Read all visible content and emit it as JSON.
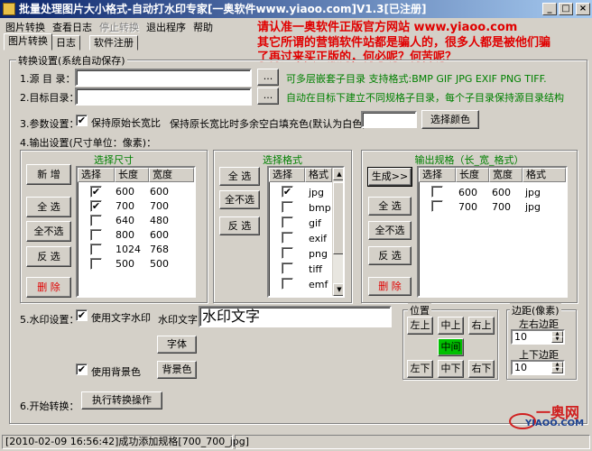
{
  "window": {
    "title": "批量处理图片大小格式-自动打水印专家[一奥软件www.yiaoo.com]V1.3[已注册]",
    "controls": [
      "_",
      "□",
      "×"
    ]
  },
  "menu": {
    "items": [
      {
        "label": "图片转换",
        "disabled": false
      },
      {
        "label": "查看日志",
        "disabled": false
      },
      {
        "label": "停止转换",
        "disabled": true
      },
      {
        "label": "退出程序",
        "disabled": false
      },
      {
        "label": "帮助",
        "disabled": false
      }
    ]
  },
  "tabs": [
    "图片转换",
    "日志",
    "软件注册"
  ],
  "promo": {
    "line1": "请认准一奥软件正版官方网站 www.yiaoo.com",
    "line2": "其它所谓的营销软件站都是骗人的，很多人都是被他们骗",
    "line3": "了再过来买正版的，何必呢？何苦呢？"
  },
  "convert_settings": {
    "legend": "转换设置(系统自动保存)",
    "source_label": "1.源 目 录：",
    "source_value": "",
    "browse_label": "...",
    "source_hint": "可多层嵌套子目录 支持格式:BMP GIF JPG EXIF PNG TIFF.",
    "target_label": "2.目标目录：",
    "target_value": "",
    "target_hint": "自动在目标下建立不同规格子目录，每个子目录保持源目录结构",
    "params_label": "3.参数设置：",
    "keep_ratio_label": "保持原始长宽比",
    "keep_ratio_checked": true,
    "fill_label": "保持原长宽比时多余空白填充色(默认为白色)：",
    "fill_value": "",
    "choose_color_label": "选择颜色",
    "output_label": "4.输出设置(尺寸单位：像素)："
  },
  "size_panel": {
    "title": "选择尺寸",
    "buttons": {
      "add": "新  增",
      "all": "全  选",
      "none": "全不选",
      "invert": "反  选",
      "delete": "删  除"
    },
    "columns": [
      "选择",
      "长度",
      "宽度"
    ],
    "rows": [
      {
        "checked": true,
        "length": "600",
        "width": "600"
      },
      {
        "checked": true,
        "length": "700",
        "width": "700"
      },
      {
        "checked": false,
        "length": "640",
        "width": "480"
      },
      {
        "checked": false,
        "length": "800",
        "width": "600"
      },
      {
        "checked": false,
        "length": "1024",
        "width": "768"
      },
      {
        "checked": false,
        "length": "500",
        "width": "500"
      }
    ]
  },
  "format_panel": {
    "title": "选择格式",
    "buttons": {
      "all": "全  选",
      "none": "全不选",
      "invert": "反  选"
    },
    "columns": [
      "选择",
      "格式"
    ],
    "rows": [
      {
        "checked": true,
        "format": "jpg"
      },
      {
        "checked": false,
        "format": "bmp"
      },
      {
        "checked": false,
        "format": "gif"
      },
      {
        "checked": false,
        "format": "exif"
      },
      {
        "checked": false,
        "format": "png"
      },
      {
        "checked": false,
        "format": "tiff"
      },
      {
        "checked": false,
        "format": "emf"
      }
    ]
  },
  "output_panel": {
    "title": "输出规格（长_宽_格式）",
    "buttons": {
      "generate": "生成>>",
      "all": "全  选",
      "none": "全不选",
      "invert": "反  选",
      "delete": "删  除"
    },
    "columns": [
      "选择",
      "长度",
      "宽度",
      "格式"
    ],
    "rows": [
      {
        "checked": false,
        "length": "600",
        "width": "600",
        "format": "jpg"
      },
      {
        "checked": false,
        "length": "700",
        "width": "700",
        "format": "jpg"
      }
    ]
  },
  "watermark": {
    "label": "5.水印设置：",
    "use_text_label": "使用文字水印",
    "use_text_checked": true,
    "text_label": "水印文字",
    "text_value": "水印文字",
    "font_label": "字体",
    "use_bg_label": "使用背景色",
    "use_bg_checked": true,
    "bg_color_label": "背景色"
  },
  "position": {
    "legend": "位置",
    "buttons": [
      "左上",
      "中上",
      "右上",
      "中间",
      "左下",
      "中下",
      "右下"
    ],
    "selected": "中间"
  },
  "margin": {
    "legend": "边距(像素)",
    "lr_label": "左右边距",
    "lr_value": "10",
    "tb_label": "上下边距",
    "tb_value": "10"
  },
  "start": {
    "label": "6.开始转换：",
    "button_label": "执行转换操作"
  },
  "status": {
    "message": "[2010-02-09 16:56:42]成功添加规格[700_700_jpg]"
  },
  "logo": {
    "text": "一奥网",
    "sub": "YIAOO.COM"
  },
  "colors": {
    "accent_green": "#008000",
    "accent_red": "#e00000",
    "title_blue": "#0a246a"
  }
}
